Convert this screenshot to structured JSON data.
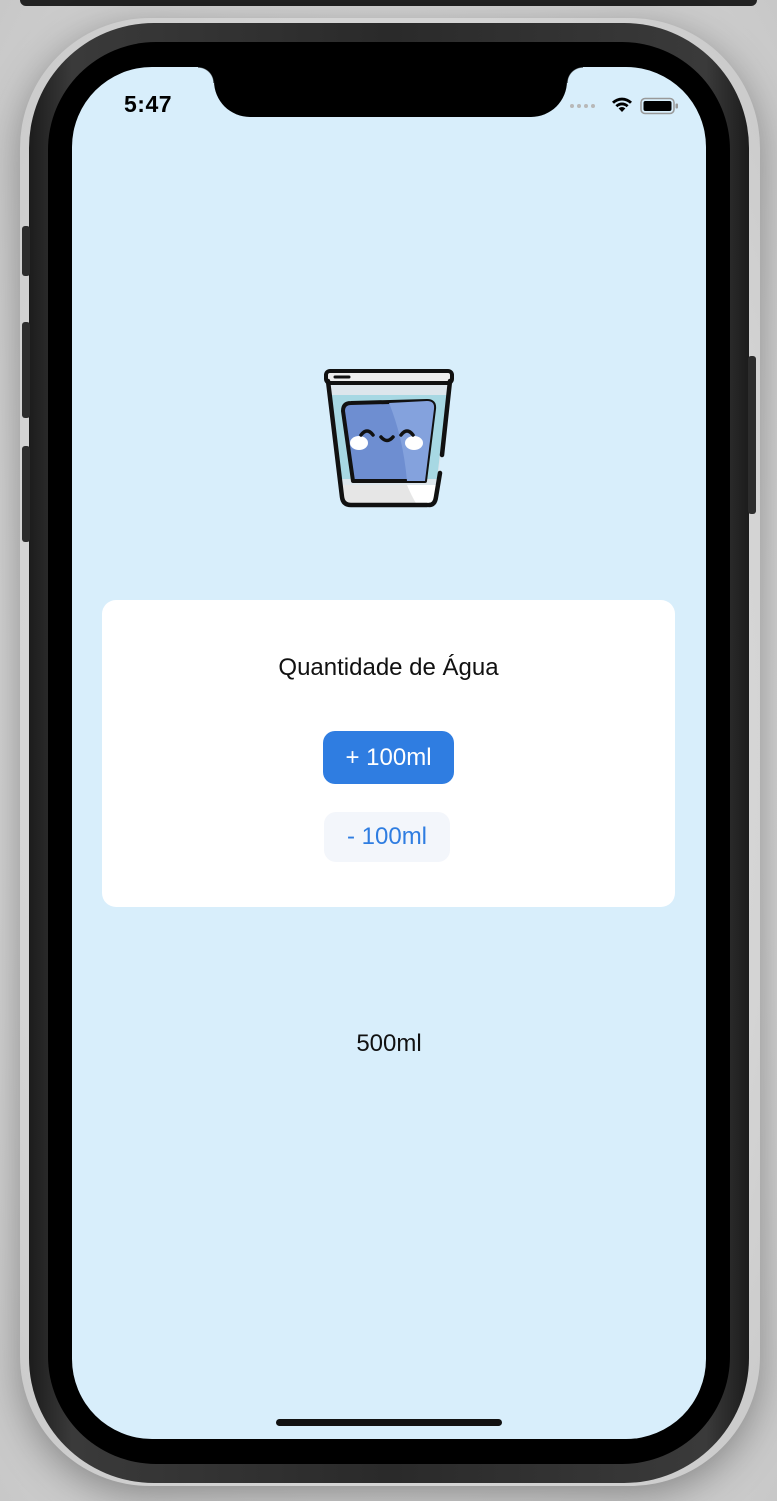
{
  "status_bar": {
    "time": "5:47",
    "icons": [
      "cellular-signal-icon",
      "wifi-icon",
      "battery-icon"
    ]
  },
  "hero": {
    "icon": "water-glass-icon"
  },
  "card": {
    "title": "Quantidade de Água",
    "increase_label": "+ 100ml",
    "decrease_label": "- 100ml"
  },
  "amount": "500ml",
  "colors": {
    "screen_background": "#d8eefb",
    "card_background": "#ffffff",
    "primary_blue": "#2f7de1",
    "secondary_button_background": "#f3f6fb"
  }
}
